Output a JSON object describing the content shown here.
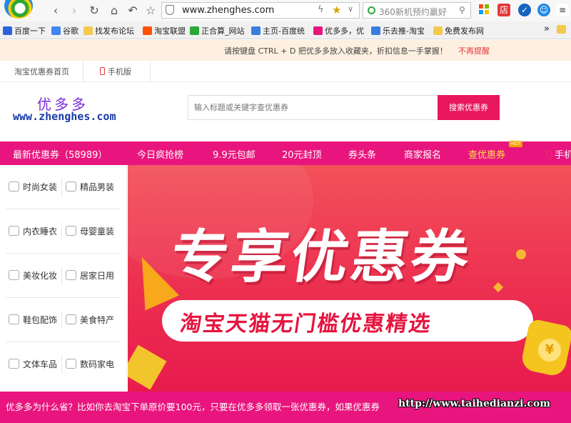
{
  "browser": {
    "url": "www.zhenghes.com",
    "search_text": "360新机预约赢好",
    "ext_labels": [
      "店"
    ]
  },
  "bookmarks": [
    {
      "label": "百度一下",
      "icon": "paw-icon",
      "color": "#2b62d9"
    },
    {
      "label": "谷歌",
      "icon": "google-icon",
      "color": "#4285f4"
    },
    {
      "label": "找发布论坛",
      "icon": "folder-icon",
      "color": "#f2c94c"
    },
    {
      "label": "淘宝联盟",
      "icon": "taobao-alliance-icon",
      "color": "#ff5000"
    },
    {
      "label": "正合算_网站",
      "icon": "site-icon",
      "color": "#2aa836"
    },
    {
      "label": "主页-百度统",
      "icon": "chart-icon",
      "color": "#3b7ddd"
    },
    {
      "label": "优多多，优",
      "icon": "coupon-icon",
      "color": "#e9157e"
    },
    {
      "label": "乐去推-淘宝",
      "icon": "push-icon",
      "color": "#3b7ddd"
    },
    {
      "label": "免费发布网",
      "icon": "folder-icon",
      "color": "#f2c94c"
    }
  ],
  "more_bookmarks": "»",
  "notice": {
    "message": "请按键盘 CTRL + D 把优多多放入收藏夹，折扣信息一手掌握！",
    "dismiss": "不再提醒"
  },
  "sitenav": {
    "home": "淘宝优惠券首页",
    "mobile": "手机版"
  },
  "brand": {
    "name": "优多多",
    "url": "www.zhenghes.com"
  },
  "search": {
    "placeholder": "输入标题或关键字查优惠券",
    "button": "搜索优惠券"
  },
  "mainnav": [
    {
      "label": "最新优惠券（58989）"
    },
    {
      "label": "今日疯抢榜"
    },
    {
      "label": "9.9元包邮"
    },
    {
      "label": "20元封顶"
    },
    {
      "label": "券头条"
    },
    {
      "label": "商家报名"
    },
    {
      "label": "查优惠券",
      "highlight": true
    },
    {
      "label": "手机"
    }
  ],
  "hot_badge": "HOT",
  "categories": [
    [
      "时尚女装",
      "精品男装"
    ],
    [
      "内衣睡衣",
      "母婴童装"
    ],
    [
      "美妆化妆",
      "居家日用"
    ],
    [
      "鞋包配饰",
      "美食特产"
    ],
    [
      "文体车品",
      "数码家电"
    ]
  ],
  "banner": {
    "title": "专享优惠券",
    "subtitle": "淘宝天猫无门槛优惠精选",
    "coin_symbol": "¥"
  },
  "ticker": {
    "text": "优多多为什么省？比如你去淘宝下单原价要100元，只要在优多多领取一张优惠券，如果优惠券",
    "watermark": "http://www.taihedianzi.com"
  },
  "colors": {
    "accent": "#e9157e",
    "search_button": "#e9175d",
    "highlight": "#ffe04a"
  }
}
